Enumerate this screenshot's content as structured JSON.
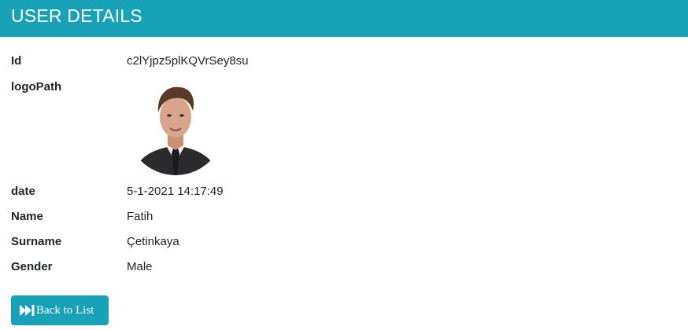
{
  "header": {
    "title": "USER DETAILS"
  },
  "details": {
    "id": {
      "label": "Id",
      "value": "c2lYjpz5plKQVrSey8su"
    },
    "logo_path": {
      "label": "logoPath"
    },
    "date": {
      "label": "date",
      "value": "5-1-2021 14:17:49"
    },
    "name": {
      "label": "Name",
      "value": "Fatih"
    },
    "surname": {
      "label": "Surname",
      "value": "Çetinkaya"
    },
    "gender": {
      "label": "Gender",
      "value": "Male"
    }
  },
  "actions": {
    "back_label": "Back to List",
    "back_icon": "fast-forward-icon"
  },
  "colors": {
    "accent": "#17a2b8",
    "text": "#212529"
  }
}
